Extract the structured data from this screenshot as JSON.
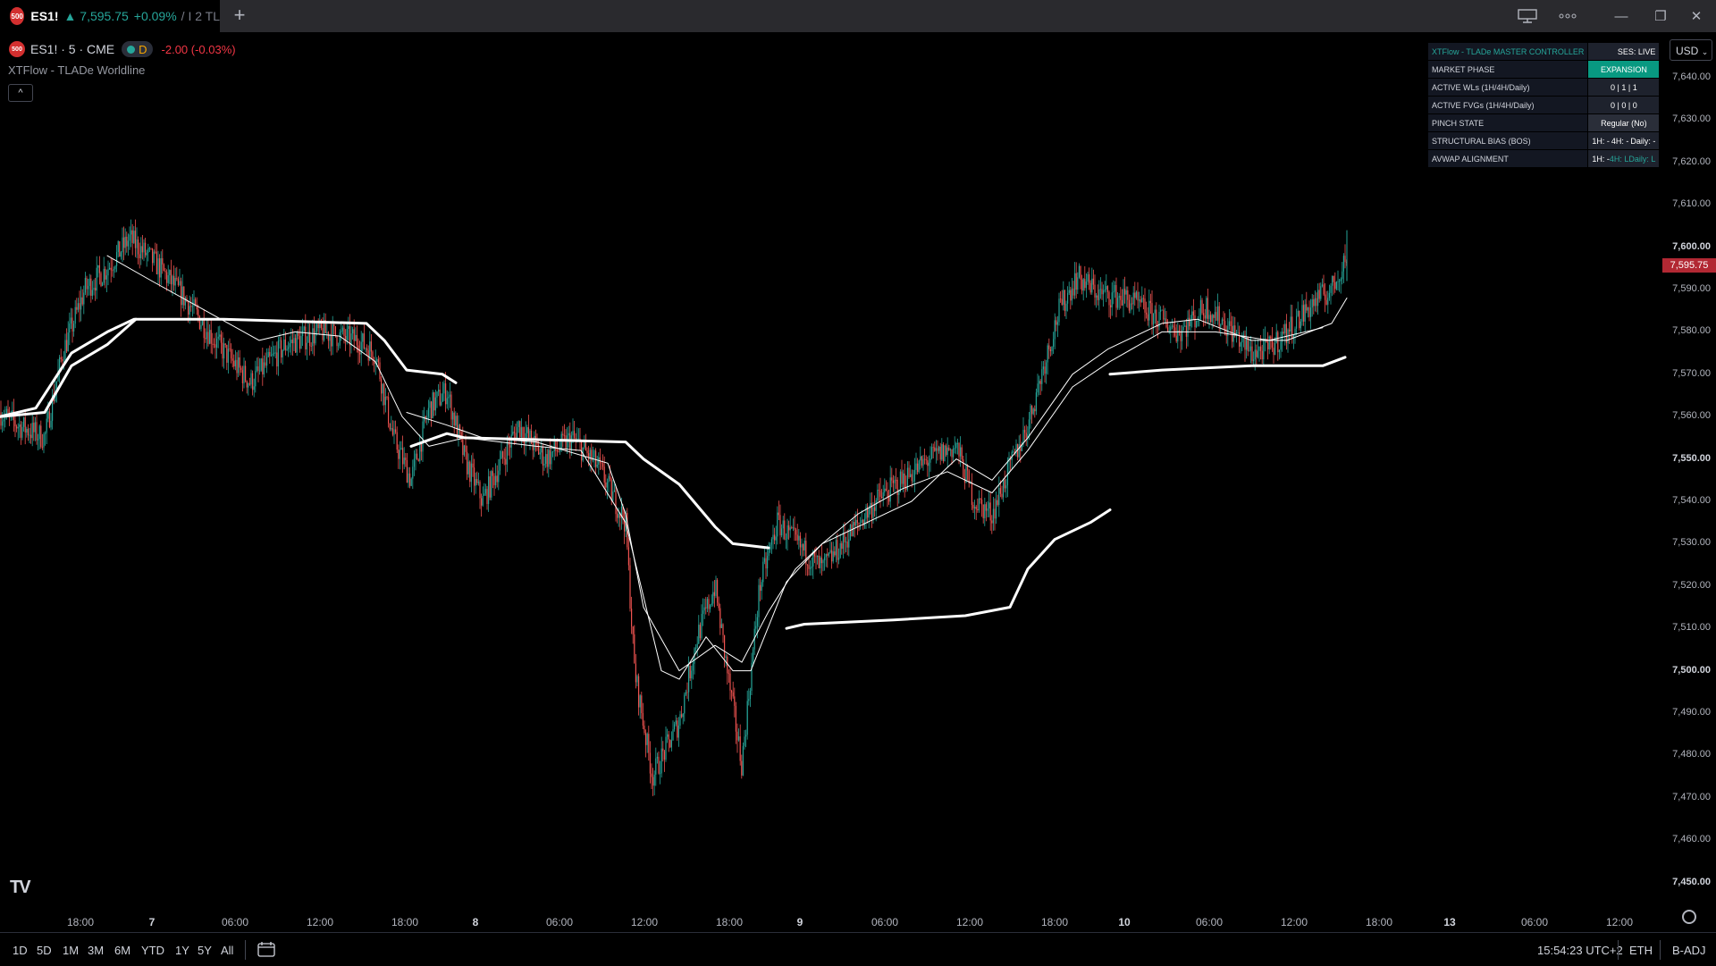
{
  "tab": {
    "badge": "500",
    "symbol": "ES1!",
    "price": "▲ 7,595.75",
    "change": "+0.09%",
    "suffix": "/ I 2 TL",
    "new_tab": "+"
  },
  "window": {
    "layout_icon": "layout-icon",
    "more_icon": "more-icon",
    "minimize": "—",
    "restore": "❐",
    "close": "✕"
  },
  "legend": {
    "badge": "500",
    "symbol": "ES1! · 5 · CME",
    "session": "D",
    "change": "-2.00 (-0.03%)",
    "indicator": "XTFlow - TLADe Worldline",
    "collapse": "^"
  },
  "tlade": {
    "title": "XTFlow - TLADe MASTER CONTROLLER",
    "session": "SES: LIVE",
    "rows": [
      {
        "label": "MARKET PHASE",
        "value": "EXPANSION"
      },
      {
        "label": "ACTIVE WLs (1H/4H/Daily)",
        "value": "0 | 1 | 1"
      },
      {
        "label": "ACTIVE FVGs (1H/4H/Daily)",
        "value": "0 | 0 | 0"
      },
      {
        "label": "PINCH STATE",
        "value": "Regular (No)"
      },
      {
        "label": "STRUCTURAL BIAS (BOS)",
        "v1": "1H: -",
        "v2": "4H: -",
        "v3": "Daily: -"
      },
      {
        "label": "AVWAP ALIGNMENT",
        "v1": "1H: -",
        "v2": "4H: L",
        "v3": "Daily: L"
      }
    ]
  },
  "price_axis": {
    "currency": "USD",
    "current": "7,595.75",
    "labels": [
      "7,640.00",
      "7,630.00",
      "7,620.00",
      "7,610.00",
      "7,600.00",
      "7,590.00",
      "7,580.00",
      "7,570.00",
      "7,560.00",
      "7,550.00",
      "7,540.00",
      "7,530.00",
      "7,520.00",
      "7,510.00",
      "7,500.00",
      "7,490.00",
      "7,480.00",
      "7,470.00",
      "7,460.00",
      "7,450.00"
    ]
  },
  "time_axis": {
    "labels": [
      {
        "t": "18:00"
      },
      {
        "t": "7",
        "bold": true
      },
      {
        "t": "06:00"
      },
      {
        "t": "12:00"
      },
      {
        "t": "18:00"
      },
      {
        "t": "8",
        "bold": true
      },
      {
        "t": "06:00"
      },
      {
        "t": "12:00"
      },
      {
        "t": "18:00"
      },
      {
        "t": "9",
        "bold": true
      },
      {
        "t": "06:00"
      },
      {
        "t": "12:00"
      },
      {
        "t": "18:00"
      },
      {
        "t": "10",
        "bold": true
      },
      {
        "t": "06:00"
      },
      {
        "t": "12:00"
      },
      {
        "t": "18:00"
      },
      {
        "t": "13",
        "bold": true
      },
      {
        "t": "06:00"
      },
      {
        "t": "12:00"
      }
    ]
  },
  "bottom": {
    "ranges": [
      "1D",
      "5D",
      "1M",
      "3M",
      "6M",
      "YTD",
      "1Y",
      "5Y",
      "All"
    ],
    "time": "15:54:23 UTC+2",
    "session": "ETH",
    "adj": "B-ADJ"
  },
  "logo": "TV",
  "chart_data": {
    "type": "candlestick",
    "timeframe": "5",
    "ylim": [
      7445,
      7645
    ],
    "candle_colors": {
      "up": "#26a69a",
      "down": "#ef5350"
    },
    "line_color": "#ffffff",
    "waypoints": [
      {
        "x": 0,
        "p": 7561
      },
      {
        "x": 20,
        "p": 7558
      },
      {
        "x": 50,
        "p": 7555
      },
      {
        "x": 70,
        "p": 7575
      },
      {
        "x": 95,
        "p": 7590
      },
      {
        "x": 120,
        "p": 7595
      },
      {
        "x": 145,
        "p": 7602
      },
      {
        "x": 175,
        "p": 7596
      },
      {
        "x": 210,
        "p": 7587
      },
      {
        "x": 240,
        "p": 7578
      },
      {
        "x": 280,
        "p": 7568
      },
      {
        "x": 320,
        "p": 7577
      },
      {
        "x": 360,
        "p": 7580
      },
      {
        "x": 400,
        "p": 7578
      },
      {
        "x": 420,
        "p": 7575
      },
      {
        "x": 440,
        "p": 7555
      },
      {
        "x": 460,
        "p": 7545
      },
      {
        "x": 480,
        "p": 7562
      },
      {
        "x": 500,
        "p": 7566
      },
      {
        "x": 520,
        "p": 7550
      },
      {
        "x": 540,
        "p": 7540
      },
      {
        "x": 580,
        "p": 7558
      },
      {
        "x": 610,
        "p": 7550
      },
      {
        "x": 640,
        "p": 7555
      },
      {
        "x": 670,
        "p": 7548
      },
      {
        "x": 700,
        "p": 7535
      },
      {
        "x": 710,
        "p": 7500
      },
      {
        "x": 730,
        "p": 7475
      },
      {
        "x": 760,
        "p": 7488
      },
      {
        "x": 780,
        "p": 7508
      },
      {
        "x": 800,
        "p": 7520
      },
      {
        "x": 815,
        "p": 7498
      },
      {
        "x": 830,
        "p": 7478
      },
      {
        "x": 850,
        "p": 7520
      },
      {
        "x": 870,
        "p": 7535
      },
      {
        "x": 900,
        "p": 7528
      },
      {
        "x": 920,
        "p": 7524
      },
      {
        "x": 950,
        "p": 7532
      },
      {
        "x": 980,
        "p": 7540
      },
      {
        "x": 1010,
        "p": 7545
      },
      {
        "x": 1040,
        "p": 7550
      },
      {
        "x": 1070,
        "p": 7553
      },
      {
        "x": 1090,
        "p": 7540
      },
      {
        "x": 1110,
        "p": 7537
      },
      {
        "x": 1130,
        "p": 7548
      },
      {
        "x": 1150,
        "p": 7558
      },
      {
        "x": 1165,
        "p": 7570
      },
      {
        "x": 1185,
        "p": 7585
      },
      {
        "x": 1205,
        "p": 7593
      },
      {
        "x": 1230,
        "p": 7589
      },
      {
        "x": 1260,
        "p": 7588
      },
      {
        "x": 1290,
        "p": 7584
      },
      {
        "x": 1320,
        "p": 7580
      },
      {
        "x": 1350,
        "p": 7586
      },
      {
        "x": 1380,
        "p": 7580
      },
      {
        "x": 1400,
        "p": 7575
      },
      {
        "x": 1420,
        "p": 7576
      },
      {
        "x": 1440,
        "p": 7580
      },
      {
        "x": 1470,
        "p": 7587
      },
      {
        "x": 1490,
        "p": 7590
      },
      {
        "x": 1507,
        "p": 7598
      }
    ],
    "lines": [
      {
        "name": "",
        "width": 3,
        "points": [
          [
            0,
            7560
          ],
          [
            40,
            7562
          ],
          [
            80,
            7575
          ],
          [
            120,
            7580
          ],
          [
            150,
            7583
          ],
          [
            250,
            7583
          ],
          [
            410,
            7582
          ],
          [
            430,
            7578
          ],
          [
            455,
            7571
          ],
          [
            495,
            7570
          ],
          [
            510,
            7568
          ]
        ]
      },
      {
        "name": "",
        "width": 3,
        "points": [
          [
            0,
            7560
          ],
          [
            50,
            7561
          ],
          [
            80,
            7572
          ],
          [
            120,
            7577
          ],
          [
            152,
            7583
          ]
        ]
      },
      {
        "name": "",
        "width": 3,
        "points": [
          [
            460,
            7553
          ],
          [
            500,
            7556
          ],
          [
            520,
            7555
          ],
          [
            700,
            7554
          ],
          [
            720,
            7550
          ],
          [
            760,
            7544
          ],
          [
            800,
            7534
          ],
          [
            820,
            7530
          ],
          [
            860,
            7529
          ]
        ]
      },
      {
        "name": "",
        "width": 3,
        "points": [
          [
            880,
            7510
          ],
          [
            900,
            7511
          ],
          [
            1000,
            7512
          ],
          [
            1080,
            7513
          ],
          [
            1130,
            7515
          ],
          [
            1150,
            7524
          ],
          [
            1180,
            7531
          ],
          [
            1220,
            7535
          ],
          [
            1242,
            7538
          ]
        ]
      },
      {
        "name": "",
        "width": 3,
        "points": [
          [
            1242,
            7570
          ],
          [
            1300,
            7571
          ],
          [
            1400,
            7572
          ],
          [
            1480,
            7572
          ],
          [
            1505,
            7574
          ]
        ]
      },
      {
        "name": "",
        "width": 1,
        "points": [
          [
            120,
            7598
          ],
          [
            170,
            7592
          ],
          [
            230,
            7585
          ],
          [
            290,
            7578
          ],
          [
            330,
            7580
          ],
          [
            380,
            7579
          ],
          [
            420,
            7573
          ],
          [
            450,
            7560
          ],
          [
            480,
            7553
          ],
          [
            520,
            7555
          ],
          [
            600,
            7553
          ],
          [
            650,
            7552
          ],
          [
            700,
            7535
          ],
          [
            740,
            7500
          ],
          [
            760,
            7498
          ],
          [
            790,
            7508
          ],
          [
            820,
            7500
          ],
          [
            840,
            7500
          ],
          [
            880,
            7521
          ],
          [
            920,
            7530
          ],
          [
            960,
            7534
          ],
          [
            1020,
            7540
          ],
          [
            1070,
            7550
          ],
          [
            1110,
            7545
          ],
          [
            1150,
            7555
          ],
          [
            1200,
            7570
          ],
          [
            1240,
            7576
          ],
          [
            1300,
            7582
          ],
          [
            1340,
            7583
          ],
          [
            1400,
            7578
          ],
          [
            1440,
            7578
          ],
          [
            1490,
            7582
          ],
          [
            1507,
            7588
          ]
        ]
      },
      {
        "name": "",
        "width": 1,
        "points": [
          [
            455,
            7561
          ],
          [
            500,
            7558
          ],
          [
            540,
            7555
          ],
          [
            600,
            7554
          ],
          [
            680,
            7549
          ],
          [
            700,
            7537
          ],
          [
            720,
            7515
          ],
          [
            760,
            7500
          ],
          [
            800,
            7506
          ],
          [
            830,
            7502
          ],
          [
            860,
            7514
          ],
          [
            890,
            7524
          ],
          [
            920,
            7530
          ],
          [
            960,
            7537
          ],
          [
            1010,
            7543
          ],
          [
            1060,
            7547
          ],
          [
            1110,
            7542
          ],
          [
            1150,
            7552
          ],
          [
            1200,
            7567
          ],
          [
            1242,
            7573
          ],
          [
            1300,
            7580
          ],
          [
            1360,
            7580
          ],
          [
            1420,
            7578
          ],
          [
            1480,
            7581
          ]
        ]
      }
    ]
  }
}
